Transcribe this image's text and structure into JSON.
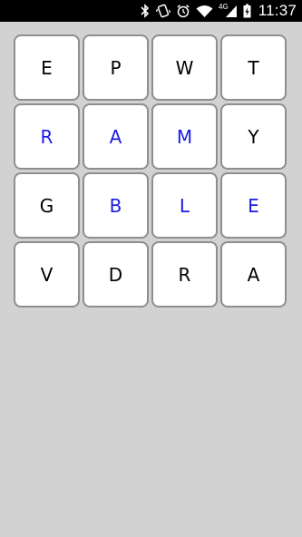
{
  "status_bar": {
    "network_label": "4G",
    "time": "11:37",
    "icons": [
      "bluetooth-icon",
      "vibrate-icon",
      "alarm-icon",
      "wifi-icon",
      "cell-signal-icon",
      "battery-charging-icon"
    ]
  },
  "colors": {
    "background": "#d2d2d2",
    "tile_background": "#ffffff",
    "tile_border": "#8e8e8e",
    "letter_default": "#000000",
    "letter_selected": "#1a1ae6"
  },
  "board": {
    "tiles": [
      {
        "letter": "E",
        "selected": false
      },
      {
        "letter": "P",
        "selected": false
      },
      {
        "letter": "W",
        "selected": false
      },
      {
        "letter": "T",
        "selected": false
      },
      {
        "letter": "R",
        "selected": true
      },
      {
        "letter": "A",
        "selected": true
      },
      {
        "letter": "M",
        "selected": true
      },
      {
        "letter": "Y",
        "selected": false
      },
      {
        "letter": "G",
        "selected": false
      },
      {
        "letter": "B",
        "selected": true
      },
      {
        "letter": "L",
        "selected": true
      },
      {
        "letter": "E",
        "selected": true
      },
      {
        "letter": "V",
        "selected": false
      },
      {
        "letter": "D",
        "selected": false
      },
      {
        "letter": "R",
        "selected": false
      },
      {
        "letter": "A",
        "selected": false
      }
    ]
  }
}
